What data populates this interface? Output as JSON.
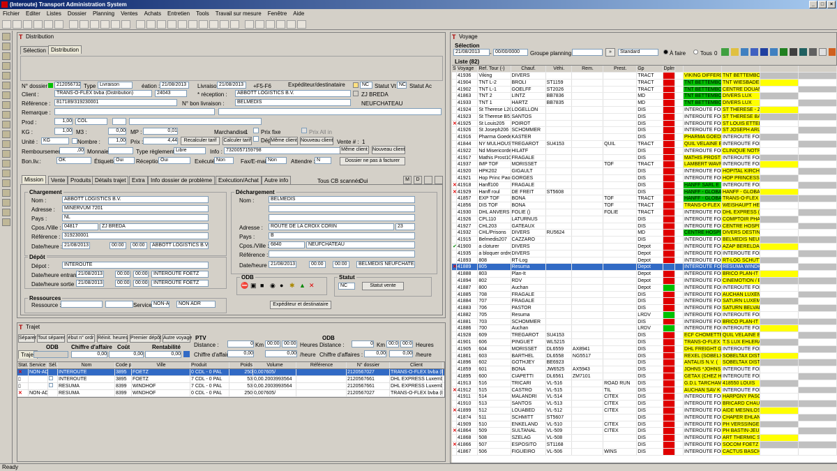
{
  "app": {
    "title": "(Interoute) Transport Administration System",
    "menu": [
      "Fichier",
      "Editer",
      "Listes",
      "Dossier",
      "Planning",
      "Ventes",
      "Achats",
      "Entretien",
      "Tools",
      "Travail sur mesure",
      "Fenêtre",
      "Aide"
    ],
    "status": "Ready"
  },
  "distribution": {
    "title": "Distribution",
    "tabs": [
      "Sélection",
      "Distribution"
    ],
    "n_dossier_label": "N° dossier :",
    "n_dossier": "2120567328",
    "type_label": "Type :",
    "type": "Livraison",
    "creation_label": "éation :",
    "creation": "21/08/2013",
    "livraison_label": "Livraison :",
    "livraison": "21/08/2013",
    "plus": "+F5-F6",
    "exp_label": "Expéditeur/destinataire",
    "statut_vt_label": "Statut Vt",
    "statut_vt": "NC",
    "statut_ac_label": "Statut Ac",
    "statut_ac": "NC",
    "nc": "NC",
    "client_label": "Client :",
    "client": "TRANS-O-FLEX bvba (Distribution)",
    "client_code": "24043",
    "reception_label": "* réception :",
    "reception": "ABBOTT LOGISTICS B.V.",
    "reception_city": "ZJ BREDA",
    "ref_label": "Référence :",
    "ref": "817189/319230001",
    "bon_label": "N° bon livraison :",
    "bon_city": "BELMEDIS",
    "bon_city2": "NEUFCHATEAU",
    "remarque_label": "Remarque :",
    "prod_label": "Prod :",
    "prod_qty": "1,00",
    "prod_unit": "COL",
    "kg_label": "KG :",
    "kg": "1,00",
    "m3_label": "M3 :",
    "m3": "0,00",
    "mp_label": "MP :",
    "mp": "0,01",
    "march_label": "Marchandise",
    "march": "1",
    "prix_fixe": "Prix fixe",
    "prix_all_in": "Prix All in",
    "depot": "Dépot",
    "unite_label": "Unité :",
    "unite": "KG",
    "nombre_label": "Nombre :",
    "nombre": "1,00",
    "prix_label": "Prix :",
    "prix": "4,44",
    "recalc": "Recalculer tarif",
    "calc": "Calculer tarif",
    "meme_client": "Même client",
    "nouveau_client": "Nouveau client",
    "vente_label": "Vente # :",
    "vente": "1",
    "remb_label": "Remboursement",
    "remb": ",00",
    "monnaie_label": "Monnaie",
    "type_reg_label": "Type règlement :",
    "type_reg": "Libre",
    "info_label": "Info :",
    "info": "7320057159798",
    "bonliv_label": "Bon.liv.:",
    "bonliv": "OK",
    "etiquette_label": "Étiquette",
    "etiquette": "Oui",
    "reception2_label": "Réceptionn",
    "reception2": "Oui",
    "execute_label": "Exécuté :",
    "execute": "Non",
    "fax_label": "Fax/E-mail :",
    "fax": "Non",
    "attendre_label": "Attendre :",
    "attendre": "N",
    "meme_client2": "Même client",
    "nouveau_client2": "Nouveau client",
    "pas_facturer": "Dossier ne pas à facturer",
    "subtabs": [
      "Mission",
      "Vente",
      "Produits",
      "Détails trajet",
      "Extra",
      "Info dossier de problème",
      "Exécution/Achat",
      "Autre info"
    ],
    "tous_cb": "Tous CB scannés:",
    "tous_cb_val": "Oui",
    "charg": {
      "cap": "Chargement",
      "nom_label": "Nom :",
      "nom": "ABBOTT LOGISTICS B.V.",
      "adresse_label": "Adresse :",
      "adresse": "MINERVUM 7201",
      "pays_label": "Pays :",
      "pays": "NL",
      "cpos_label": "Cpos./Ville :",
      "cpos": "04817",
      "ville": "ZJ BREDA",
      "ref_label": "Référence :",
      "ref": "319230001",
      "date_label": "Date/heure :",
      "date": "21/08/2013",
      "t1": "00:00",
      "t2": "00:00",
      "who": "ABBOTT LOGISTICS B.V."
    },
    "dech": {
      "cap": "Déchargement",
      "nom_label": "Nom :",
      "nom": "BELMEDIS",
      "adresse_label": "Adresse :",
      "adresse": "ROUTE DE LA CROIX CORIN",
      "num": "23",
      "pays_label": "Pays :",
      "pays": "B",
      "cpos_label": "Cpos./Ville :",
      "cpos": "6840",
      "ville": "NEUFCHATEAU",
      "ref_label": "Référence :",
      "date_label": "Date/heure :",
      "date": "21/08/2013",
      "t1": "00:00",
      "t2": "00:00",
      "who": "BELMEDIS NEUFCHATEAU"
    },
    "depotg": {
      "cap": "Dépôt",
      "depot_label": "Dépot :",
      "depot": "INTEROUTE",
      "de_label": "Date/heure entrant :",
      "de": "21/08/2013",
      "de1": "00:00",
      "de2": "00:00",
      "de_who": "INTEROUTE FOETZ",
      "ds_label": "Date/heure sortie :",
      "ds": "21/08/2013",
      "ds1": "00:00",
      "ds2": "00:00",
      "ds_who": "INTEROUTE FOETZ"
    },
    "odb": "ODB",
    "statut_cap": "Statut",
    "statut_nc": "NC",
    "statut_vente": "Statut vente",
    "exp_dest_btn": "Expéditeur et destinataire",
    "res": {
      "cap": "Ressources",
      "res_label": "Ressource :",
      "service_label": "Service :",
      "service": "NON-ADR",
      "service2": "NON ADR"
    }
  },
  "trajet": {
    "title": "Trajet",
    "btns": [
      "Séparer",
      "Tout séparer",
      "ébut n° ordr",
      "Réinit. heures",
      "Premier dépôt",
      "Autre voyage"
    ],
    "odb": "ODB",
    "chiffre": "Chiffre d'affaire",
    "cout": "Coût",
    "rentab": "Rentabilité",
    "ptv": "PTV",
    "distance_label": "Distance :",
    "distance": "0",
    "km": "Km",
    "t": "00:00",
    "heures": "Heures",
    "chiffre_label": "Chiffre d'affaires :",
    "chiffre_val": "0,00",
    "heure": "/heure",
    "odb2": "ODB",
    "distance2": "0",
    "chiffre2": "0,00",
    "trajet_tab": "Trajet",
    "ca": "0,00",
    "couts": "0,00",
    "rent": "0,00",
    "cols": [
      "Stat.",
      "Service",
      "Sél.",
      "Nom",
      "Code p",
      "Ville",
      "Produit",
      "Poids",
      "Volume",
      "Référence",
      "N° dossier",
      "Client"
    ],
    "rows": [
      {
        "x": true,
        "service": "NON-ADR",
        "nom": "INTEROUTE",
        "code": "3895",
        "ville": "FOETZ",
        "produit": "0 CDL - 0 PAL",
        "poids": "250",
        "volume": "0,007605/",
        "ref": "",
        "dossier": "2120567027",
        "client": "TRANS-O-FLEX bvba (Di"
      },
      {
        "x": false,
        "service": "",
        "nom": "INTEROUTE",
        "code": "3895",
        "ville": "FOETZ",
        "produit": "7 CDL - 0 PAL",
        "poids": "53",
        "volume": "0,00.2003993564",
        "ref": "",
        "dossier": "2120567661",
        "client": "DHL EXPRESS Luxembo"
      },
      {
        "x": false,
        "service": "",
        "nom": "RESUMA",
        "code": "8399",
        "ville": "WINDHOF",
        "produit": "7 CDL - 0 PAL",
        "poids": "53",
        "volume": "0,00.2003993564",
        "ref": "",
        "dossier": "2120567661",
        "client": "DHL EXPRESS Luxembo"
      },
      {
        "x": true,
        "service": "NON-ADR",
        "nom": "RESUMA",
        "code": "8399",
        "ville": "WINDHOF",
        "produit": "0 CDL - 0 PAL",
        "poids": "250",
        "volume": "0,007605/",
        "ref": "",
        "dossier": "2120567027",
        "client": "TRANS-O-FLEX bvba (Di"
      }
    ]
  },
  "voyage": {
    "title": "Voyage",
    "selection": "Sélection",
    "date_from": "21/08/2013",
    "date_to": "00/00/0000",
    "groupe_label": "Groupe planning :",
    "standard": "Standard",
    "a_faire": "À faire",
    "tous": "Tous",
    "tous_n": "0",
    "liste": "Liste (82)",
    "cols": [
      "St",
      "Voyage",
      "Ref. Tour (-)",
      "Chauf.",
      "Véhi.",
      "Rem.",
      "Prest.",
      "Gp",
      "Dplm"
    ],
    "rows": [
      [
        "",
        "41936",
        "Viking",
        "DIVERS",
        "",
        "",
        "",
        "TRACT",
        "r",
        "VIKING DIFFERD",
        "TNT BETTEMBOU"
      ],
      [
        "",
        "41904",
        "TNT L-2",
        "BROLI",
        "ST1159",
        "",
        "",
        "TRACT",
        "r",
        "TNT BETTEMBOU",
        "TNT WIESBADEN"
      ],
      [
        "",
        "41902",
        "TNT L-1",
        "GOELFF",
        "ST2026",
        "",
        "",
        "TRACT",
        "r",
        "TNT BETTEMBOU",
        "CENTRE DOUAN"
      ],
      [
        "",
        "41863",
        "TNT 2",
        "LINTZ",
        "BB7836",
        "",
        "",
        "MD",
        "r",
        "TNT BETTEMBOU",
        "DIVERS LUX"
      ],
      [
        "",
        "41933",
        "TNT 1",
        "HARTZ",
        "BB7835",
        "",
        "",
        "MD",
        "r",
        "TNT BETTEMBOU",
        "DIVERS LUX"
      ],
      [
        "",
        "41924",
        "St Therese L201",
        "LOGELLON",
        "",
        "",
        "",
        "DIS",
        "r",
        "INTEROUTE FOE",
        "ST THERESE - ZI"
      ],
      [
        "",
        "41923",
        "St Therese B51",
        "SANTOS",
        "",
        "",
        "",
        "DIS",
        "r",
        "INTEROUTE FOE",
        "ST THERESE BA"
      ],
      [
        "x",
        "41925",
        "St Louis205",
        "POIROT",
        "",
        "",
        "",
        "DIS",
        "r",
        "INTEROUTE FOE",
        "ST LOUIS ETTEL"
      ],
      [
        "",
        "41926",
        "St Joseph206",
        "SCHOMMER",
        "",
        "",
        "",
        "DIS",
        "r",
        "INTEROUTE FOE",
        "ST JOSEPH ARLI"
      ],
      [
        "",
        "41916",
        "Pharma Goeden",
        "KASTER",
        "",
        "",
        "",
        "DIS",
        "r",
        "PHARMA GOEDE",
        "INTEROUTE FOE"
      ],
      [
        "",
        "41844",
        "NY MULHOUSE",
        "TREGAROT",
        "SU4153",
        "",
        "QUIL",
        "TRACT",
        "r",
        "QUIL VELAINE E",
        "INTEROUTE FOE"
      ],
      [
        "",
        "41922",
        "Nd Misericorde2",
        "HILATF",
        "",
        "",
        "",
        "DIS",
        "r",
        "INTEROUTE FOE",
        "CLINIQUE NOTRE"
      ],
      [
        "",
        "41917",
        "Mathis Prost100",
        "FRAGALE",
        "",
        "",
        "",
        "DIS",
        "r",
        "MATHIS PROST",
        "INTEROUTE FOE"
      ],
      [
        "",
        "41937",
        "IMP TOF",
        "MORISSET",
        "",
        "",
        "TOF",
        "TRACT",
        "r",
        "LAMBERT WAVR",
        "INTEROUTE FOE"
      ],
      [
        "",
        "41920",
        "HPK202",
        "GIGAULT",
        "",
        "",
        "",
        "DIS",
        "r",
        "INTEROUTE FOE",
        "HOPITAL KIRCH"
      ],
      [
        "",
        "41921",
        "Hop Princ Paola",
        "GORGES",
        "",
        "",
        "",
        "DIS",
        "r",
        "INTEROUTE FOE",
        "HOP PRINCESSE"
      ],
      [
        "x",
        "41918",
        "Hanff100",
        "FRAGALE",
        "",
        "",
        "",
        "DIS",
        "r",
        "HANFF SARL E",
        "INTEROUTE FOE"
      ],
      [
        "x",
        "41929",
        "Hanff roul",
        "DE FREIT",
        "ST5608",
        "",
        "",
        "DIS",
        "r",
        "HANFF - GLOBA",
        "HANFF - GLOBA"
      ],
      [
        "",
        "41857",
        "EXP TOF",
        "BONA",
        "",
        "",
        "TOF",
        "TRACT",
        "r",
        "HANFF - GLOBA",
        "TRANS-O-FLEX"
      ],
      [
        "",
        "41856",
        "DIS TOF",
        "BONA",
        "",
        "",
        "TOF",
        "TRACT",
        "r",
        "TRANS-O-FLEX",
        "WEISHAUPT HER"
      ],
      [
        "",
        "41930",
        "DHL ANVERS",
        "FOLIE ()",
        "",
        "",
        "FOLIE",
        "TRACT",
        "r",
        "INTEROUTE FOE",
        "DHL EXPRESS (A"
      ],
      [
        "",
        "41926",
        "CPL110",
        "LATURNUS",
        "",
        "",
        "",
        "DIS",
        "r",
        "INTEROUTE FOE",
        "COMPTOIR PHAR"
      ],
      [
        "",
        "41927",
        "CHL203",
        "GATEAUX",
        "",
        "",
        "",
        "DIS",
        "r",
        "INTEROUTE FOE",
        "CENTRE HOSPITA"
      ],
      [
        "",
        "41932",
        "CHL/Prisons",
        "DIVERS",
        "RU5624",
        "",
        "",
        "MD",
        "r",
        "CENTRE HOSPITA",
        "DIVERS DESTINA"
      ],
      [
        "",
        "41915",
        "Belmedis207",
        "CAZZARO",
        "",
        "",
        "",
        "DIS",
        "r",
        "INTEROUTE FOE",
        "BELMEDIS NEUFC"
      ],
      [
        "v",
        "41900",
        "a cloturer",
        "DIVERS",
        "",
        "",
        "",
        "Depot",
        "r",
        "INTEROUTE FOE",
        "AZAP BERELDA"
      ],
      [
        "",
        "41935",
        "a bloquer ordre 1",
        "DIVERS",
        "",
        "",
        "",
        "Depot",
        "r",
        "INTEROUTE FOE",
        "INTEROUTE FOE"
      ],
      [
        "",
        "41893",
        "808",
        "RT-Log",
        "",
        "",
        "",
        "Depot",
        "r",
        "INTEROUTE FOE",
        "RT-LOG SCHUTT"
      ],
      [
        "x",
        "41889",
        "805",
        "Resuma",
        "",
        "",
        "",
        "Depot",
        "b",
        "INTEROUTE FOE",
        "RESUMA WINDH"
      ],
      [
        "",
        "41888",
        "803",
        "Plan-It",
        "",
        "",
        "",
        "Depot",
        "r",
        "INTEROUTE FOE",
        "BRICO PLAN-IT"
      ],
      [
        "",
        "41894",
        "802",
        "RDV",
        "",
        "",
        "",
        "Depot",
        "r",
        "INTEROUTE FOE",
        "CINEMOTION / E"
      ],
      [
        "",
        "41887",
        "800",
        "Auchan",
        "",
        "",
        "",
        "Depot",
        "g",
        "INTEROUTE FOE",
        "INTEROUTE FOE"
      ],
      [
        "",
        "41885",
        "708",
        "FRAGALE",
        "",
        "",
        "",
        "DIS",
        "r",
        "INTEROUTE FOE",
        "AUCHAN LUXEM"
      ],
      [
        "",
        "41884",
        "707",
        "FRAGALE",
        "",
        "",
        "",
        "DIS",
        "r",
        "INTEROUTE FOE",
        "SATURN LUXEM"
      ],
      [
        "",
        "41883",
        "706",
        "PASTOR",
        "",
        "",
        "",
        "DIS",
        "r",
        "INTEROUTE FOE",
        "SATURN BELVAL"
      ],
      [
        "",
        "41882",
        "705",
        "Resuma",
        "",
        "",
        "",
        "LRDV",
        "g",
        "INTEROUTE FOE",
        "INTEROUTE FOE"
      ],
      [
        "",
        "41881",
        "703",
        "SCHOMMER",
        "",
        "",
        "",
        "DIS",
        "r",
        "INTEROUTE FOE",
        "BRICO PLAN-IT"
      ],
      [
        "",
        "41886",
        "700",
        "Auchan",
        "",
        "",
        "",
        "LRDV",
        "g",
        "INTEROUTE FOE",
        "INTEROUTE FOE"
      ],
      [
        "",
        "41928",
        "609",
        "TREGAROT",
        "SU4153",
        "",
        "",
        "DIS",
        "r",
        "ECF CHOMETTE",
        "QUIL VELAINE E"
      ],
      [
        "",
        "41901",
        "606",
        "PINGUET",
        "WL5215",
        "",
        "",
        "DIS",
        "r",
        "TRANS-O-FLEX",
        "T.S LUX EHLERA"
      ],
      [
        "",
        "41905",
        "604",
        "MORISSET",
        "DL6559",
        "AX8941",
        "",
        "DIS",
        "r",
        "DHL FREIGHT G",
        "INTEROUTE FOE"
      ],
      [
        "",
        "41861",
        "603",
        "BARTHEL",
        "DL6558",
        "NG5517",
        "",
        "DIS",
        "r",
        "REXEL (SOBELX",
        "SOBELTAX DISTI"
      ],
      [
        "",
        "41896",
        "602",
        "GOTHJEY",
        "BE6923",
        "",
        "",
        "DIS",
        "r",
        "ANTALIS N.V. (",
        "SOBELTAX DISTI"
      ],
      [
        "",
        "41859",
        "601",
        "BONA",
        "JW6525",
        "AX5943",
        "",
        "DIS",
        "r",
        "JOHNS *JOHNS",
        "INTEROUTE FOE"
      ],
      [
        "",
        "41895",
        "600",
        "CIAPETTI",
        "DL6561",
        "ZM7101",
        "",
        "DIS",
        "r",
        "GETAX (CHEZ H",
        "INTEROUTE FOE"
      ],
      [
        "",
        "41913",
        "516",
        "TRICARI",
        "VL-516",
        "",
        "ROAD RUN",
        "DIS",
        "r",
        "G.D.L TARCHAM",
        "418550 LOUIS"
      ],
      [
        "x",
        "41912",
        "515",
        "CASTRO",
        "VL-515",
        "",
        "TIL",
        "DIS",
        "r",
        "AUCHAN SAV K",
        "INTEROUTE FOE"
      ],
      [
        "",
        "41911",
        "514",
        "MALANDRI",
        "VL-514",
        "",
        "CITEX",
        "DIS",
        "r",
        "INTEROUTE FOE",
        "HARPGNY PASC"
      ],
      [
        "",
        "41910",
        "513",
        "SANTOS",
        "VL-513",
        "",
        "CITEX",
        "DIS",
        "r",
        "INTEROUTE FOE",
        "BRICARD CHAU"
      ],
      [
        "x",
        "41899",
        "512",
        "LOUABED",
        "VL-512",
        "",
        "CITEX",
        "DIS",
        "r",
        "INTEROUTE FOE",
        "AIDE MESNILOS"
      ],
      [
        "",
        "41874",
        "511",
        "SCHMITT",
        "ST5607",
        "",
        "",
        "DIS",
        "r",
        "INTEROUTE FOE",
        "CHAPER EHLAN"
      ],
      [
        "",
        "41909",
        "510",
        "ENKELAND",
        "VL-510",
        "",
        "CITEX",
        "DIS",
        "r",
        "INTEROUTE FOE",
        "PH VERSSINGEN"
      ],
      [
        "x",
        "41864",
        "509",
        "SULTANAL",
        "VL-509",
        "",
        "CITEX",
        "DIS",
        "r",
        "INTEROUTE FOE",
        "PH BASTIN-JEU"
      ],
      [
        "",
        "41868",
        "508",
        "SZELAG",
        "VL-508",
        "",
        "",
        "DIS",
        "r",
        "INTEROUTE FOE",
        "ART THERMIC S"
      ],
      [
        "x",
        "41866",
        "507",
        "ESPOSITO",
        "ST1168",
        "",
        "",
        "DIS",
        "r",
        "INTEROUTE FOE",
        "SOCOM FOETZ"
      ],
      [
        "",
        "41867",
        "506",
        "FIGUEIRO",
        "VL-506",
        "",
        "WINS",
        "DIS",
        "r",
        "INTEROUTE FOE",
        "CACTUS BASCH"
      ]
    ]
  },
  "colors": {
    "red": "#e00000",
    "selected": "#316ac5",
    "yellow": "#ffff00",
    "green": "#00c000",
    "grey": "#c0c0c0"
  }
}
